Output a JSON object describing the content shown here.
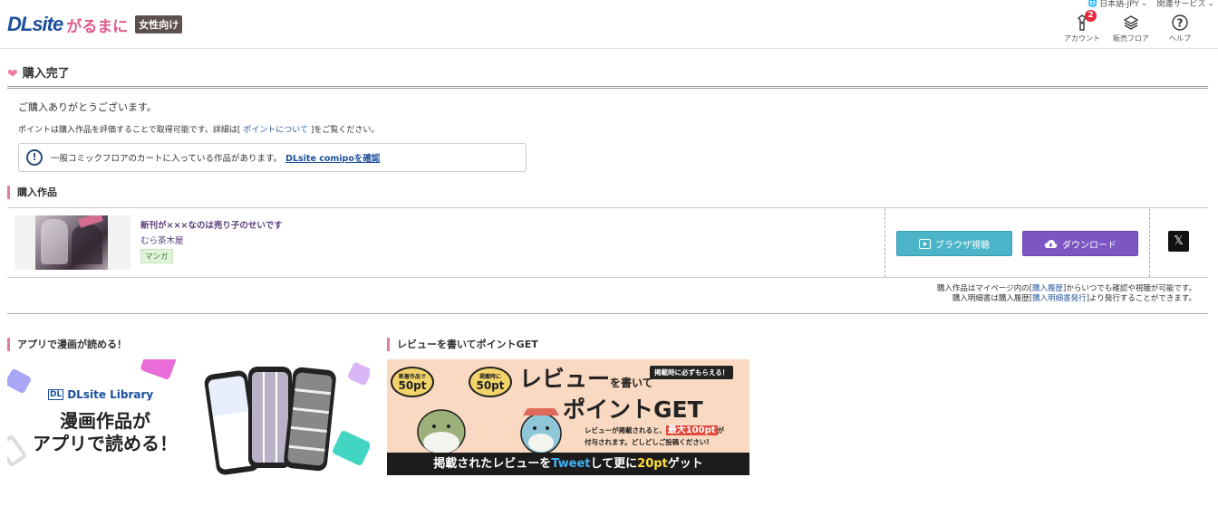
{
  "header": {
    "logo_text": "DLsite",
    "logo_sub": "がるまに",
    "logo_badge": "女性向け",
    "language": "日本語-JPY",
    "related": "関連サービス",
    "icons": [
      {
        "label": "アカウント",
        "icon": "account-icon",
        "badge": "2"
      },
      {
        "label": "販売フロア",
        "icon": "floor-icon"
      },
      {
        "label": "ヘルプ",
        "icon": "help-icon"
      }
    ]
  },
  "page": {
    "title": "購入完了",
    "thanks": "ご購入ありがとうございます。",
    "points_pre": "ポイントは購入作品を評価することで取得可能です。詳細は[",
    "points_link": "ポイントについて",
    "points_post": "]をご覧ください。",
    "notice_text": "一般コミックフロアのカートに入っている作品があります。",
    "notice_link": "DLsite comipoを確認"
  },
  "purchased": {
    "section_title": "購入作品",
    "items": [
      {
        "title": "新刊が×××なのは売り子のせいです",
        "maker": "むら茶木屋",
        "genre": "マンガ",
        "browse_label": "ブラウザ視聴",
        "download_label": "ダウンロード"
      }
    ],
    "help_line1_pre": "購入作品はマイページ内の[",
    "help_line1_link": "購入履歴",
    "help_line1_post": "]からいつでも確認や視聴が可能です。",
    "help_line2_pre": "購入明細書は購入履歴[",
    "help_line2_link": "購入明細書発行",
    "help_line2_post": "]より発行することができます。"
  },
  "banners": {
    "app": {
      "section_title": "アプリで漫画が読める！",
      "brand": "DLsite Library",
      "brand_mini": "DL",
      "headline1": "漫画作品が",
      "headline2": "アプリで読める！"
    },
    "review": {
      "section_title": "レビューを書いてポイントGET",
      "bubble1_small": "新着作品で",
      "bubble1_big": "50pt",
      "bubble2_small": "掲載時に",
      "bubble2_big": "50pt",
      "big1": "レビュー",
      "big1_small": "を書いて",
      "big2": "ポイントGET",
      "tag": "掲載時に必ずもらえる！",
      "desc1_pre": "レビューが掲載されると、",
      "desc1_red": "最大100pt",
      "desc1_post": "が",
      "desc2": "付与されます。どしどしご投稿ください!",
      "bottom_pre": "掲載されたレビューを",
      "bottom_tw": "Tweet",
      "bottom_mid": "して更に",
      "bottom_pt": "20pt",
      "bottom_post": "ゲット"
    }
  },
  "colors": {
    "brand_blue": "#1b4f9c",
    "pink_accent": "#e57aa6",
    "browse_btn": "#4cb4c9",
    "download_btn": "#7e56c4"
  }
}
